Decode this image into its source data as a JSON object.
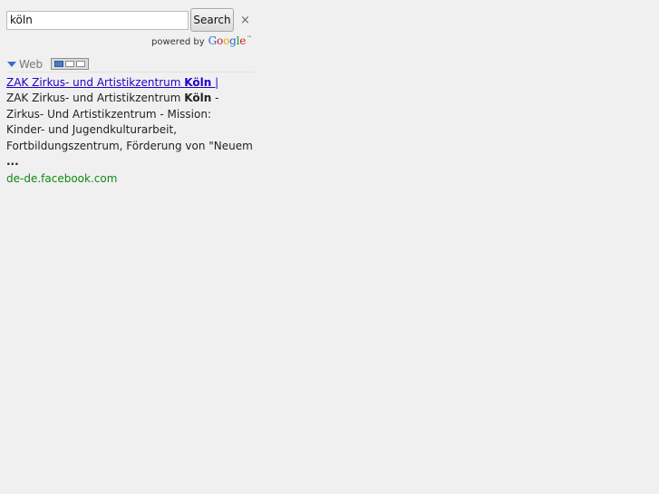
{
  "search": {
    "query": "köln",
    "button_label": "Search",
    "clear_symbol": "×"
  },
  "branding": {
    "powered_by": "powered by",
    "google_logo_letters": [
      "G",
      "o",
      "o",
      "g",
      "l",
      "e"
    ],
    "google_logo_colors": [
      "#3366cc",
      "#cc2222",
      "#e8a800",
      "#3366cc",
      "#229922",
      "#cc2222"
    ],
    "trademark": "™"
  },
  "tabs": {
    "web_label": "Web",
    "view_icons": [
      "single-column-view-icon",
      "two-column-view-icon",
      "three-column-view-icon"
    ]
  },
  "results": [
    {
      "title_prefix": "ZAK Zirkus- und Artistikzentrum ",
      "title_bold": "Köln",
      "title_suffix": " |",
      "snippet_part1": "ZAK Zirkus- und Artistikzentrum ",
      "snippet_bold1": "Köln",
      "snippet_part2": " - Zirkus- Und Artistikzentrum - Mission: Kinder- und Jugendkulturarbeit, Fortbildungszentrum, Förderung von \"Neuem ",
      "snippet_bold2": "...",
      "url": "de-de.facebook.com"
    }
  ],
  "colors": {
    "page_background": "#f0f0f0",
    "link": "#2200cc",
    "url_green": "#118811",
    "tab_triangle": "#3a6ecd"
  }
}
